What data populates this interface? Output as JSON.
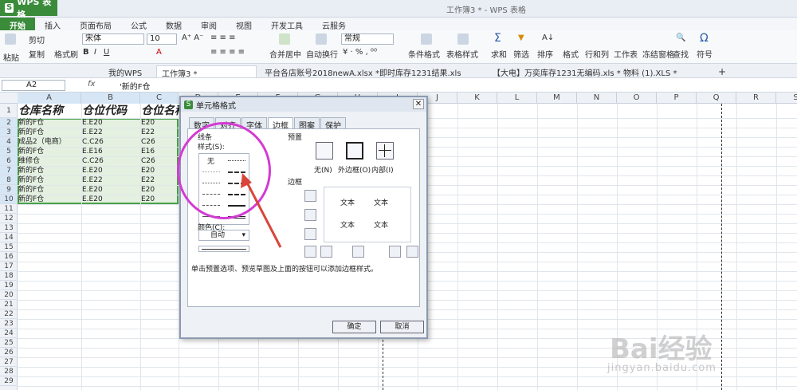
{
  "titlebar": {
    "app_name": "WPS 表格",
    "window_title": "工作簿3 * - WPS 表格"
  },
  "menu_tabs": [
    "开始",
    "插入",
    "页面布局",
    "公式",
    "数据",
    "审阅",
    "视图",
    "开发工具",
    "云服务"
  ],
  "ribbon": {
    "paste": "粘贴",
    "cut": "剪切",
    "copy": "复制",
    "format_painter": "格式刷",
    "font_name": "宋体",
    "font_size": "10",
    "merge": "合并居中",
    "wrap": "自动换行",
    "number_format": "常规",
    "cond_format": "条件格式",
    "table_style": "表格样式",
    "sum": "求和",
    "filter": "筛选",
    "sort": "排序",
    "format": "格式",
    "row_col": "行和列",
    "worksheet": "工作表",
    "freeze": "冻结窗格",
    "find": "查找",
    "symbol": "符号"
  },
  "doc_tabs": [
    "我的WPS",
    "工作簿3 *",
    "平台各店账号2018newA.xlsx *",
    "即时库存1231结果.xls",
    "【大电】万奕库存1231无编码.xls *",
    "物料 (1).XLS *"
  ],
  "formula_bar": {
    "cell_ref": "A2",
    "fx": "fx",
    "value": "'新的F仓"
  },
  "columns": [
    "A",
    "B",
    "C",
    "D",
    "E",
    "F",
    "G",
    "H",
    "I",
    "J",
    "K",
    "L",
    "M",
    "N",
    "O",
    "P",
    "Q",
    "R",
    "S"
  ],
  "rows": [
    "1",
    "2",
    "3",
    "4",
    "5",
    "6",
    "7",
    "8",
    "9",
    "10",
    "11",
    "12",
    "13",
    "14",
    "15",
    "16",
    "17",
    "18",
    "19",
    "20",
    "21",
    "22",
    "23",
    "24",
    "25",
    "26",
    "27",
    "28",
    "29"
  ],
  "table": {
    "headers": [
      "仓库名称",
      "仓位代码",
      "仓位名称"
    ],
    "rows": [
      [
        "新的F仓",
        "E.E20",
        "E20"
      ],
      [
        "新的F仓",
        "E.E22",
        "E22"
      ],
      [
        "成品2（电商）",
        "C.C26",
        "C26"
      ],
      [
        "新的F仓",
        "E.E16",
        "E16"
      ],
      [
        "维修仓",
        "C.C26",
        "C26"
      ],
      [
        "新的F仓",
        "E.E20",
        "E20"
      ],
      [
        "新的F仓",
        "E.E22",
        "E22"
      ],
      [
        "新的F仓",
        "E.E20",
        "E20"
      ],
      [
        "新的F仓",
        "E.E20",
        "E20"
      ]
    ]
  },
  "dialog": {
    "title": "单元格格式",
    "tabs": [
      "数字",
      "对齐",
      "字体",
      "边框",
      "图案",
      "保护"
    ],
    "line_section": "线条",
    "style_label": "样式(S):",
    "none_style": "无",
    "color_label": "颜色(C):",
    "color_value": "自动",
    "presets_label": "预置",
    "preset_none": "无(N)",
    "preset_outline": "外边框(O)",
    "preset_inside": "内部(I)",
    "border_label": "边框",
    "preview_text": "文本",
    "hint": "单击预置选项、预览草图及上面的按钮可以添加边框样式。",
    "ok": "确定",
    "cancel": "取消"
  },
  "watermark": {
    "brand": "Bai经验",
    "url": "jingyan.baidu.com"
  }
}
